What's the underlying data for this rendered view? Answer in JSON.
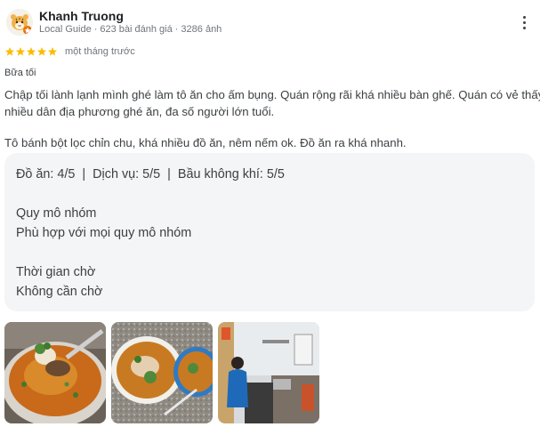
{
  "reviewer": {
    "name": "Khanh Truong",
    "badge": "Local Guide",
    "reviews": "623 bài đánh giá",
    "photos": "3286 ảnh"
  },
  "rating": {
    "stars": 5,
    "max": 5,
    "time": "một tháng trước",
    "star_color": "#fbbc04"
  },
  "meal_type": "Bữa tối",
  "review": {
    "paragraph1_line1": "Chập tối lành lạnh mình ghé làm tô ăn cho ấm bụng. Quán rộng rãi khá nhiều bàn ghế. Quán có vẻ thấy",
    "paragraph1_line2": "nhiều dân địa phương ghé ăn, đa số người lớn tuổi.",
    "paragraph2": "Tô bánh bột lọc chỉn chu, khá nhiều đồ ăn, nêm nếm ok. Đồ ăn ra khá nhanh."
  },
  "details": {
    "food": "Đồ ăn: 4/5",
    "service": "Dịch vụ: 5/5",
    "atmosphere": "Bầu không khí: 5/5",
    "separator": "|",
    "group_size_label": "Quy mô nhóm",
    "group_size_value": "Phù hợp với mọi quy mô nhóm",
    "wait_time_label": "Thời gian chờ",
    "wait_time_value": "Không cần chờ"
  },
  "photos": [
    {
      "icon": "soup-bowl-photo"
    },
    {
      "icon": "two-bowls-photo"
    },
    {
      "icon": "kitchen-photo"
    }
  ]
}
